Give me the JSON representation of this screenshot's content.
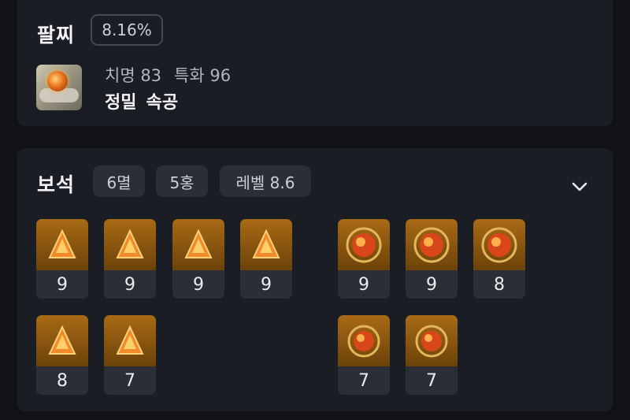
{
  "bracelet": {
    "title": "팔찌",
    "percent": "8.16%",
    "icon": "bracelet-icon",
    "stats": [
      "치명 83",
      "특화 96"
    ],
    "engravings": [
      "정밀",
      "속공"
    ]
  },
  "gems": {
    "title": "보석",
    "badges": [
      "6멸",
      "5홍",
      "레벨 8.6"
    ],
    "expand_icon": "chevron-down-icon",
    "annihilation": [
      "9",
      "9",
      "9",
      "9",
      "8",
      "7"
    ],
    "crimson": [
      "9",
      "9",
      "8",
      "7",
      "7"
    ]
  },
  "colors": {
    "background": "#111216",
    "card": "#1b1d24",
    "pill": "#2b2e37",
    "gem_gold": "#a86a16"
  }
}
